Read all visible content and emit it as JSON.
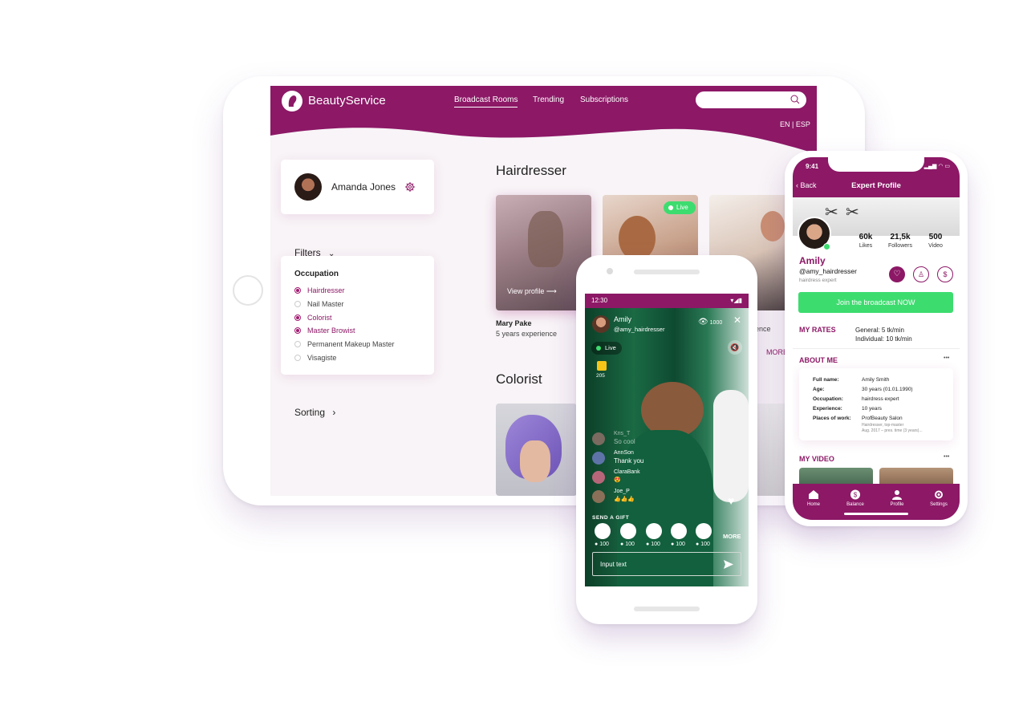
{
  "web": {
    "brand": "BeautyService",
    "nav": [
      "Broadcast Rooms",
      "Trending",
      "Subscriptions"
    ],
    "lang": "EN | ESP",
    "user_name": "Amanda Jones",
    "filters_label": "Filters",
    "occupation_title": "Occupation",
    "occupations": [
      {
        "label": "Hairdresser",
        "checked": true
      },
      {
        "label": "Nail Master",
        "checked": false
      },
      {
        "label": "Colorist",
        "checked": true
      },
      {
        "label": "Master Browist",
        "checked": true
      },
      {
        "label": "Permanent Makeup Master",
        "checked": false
      },
      {
        "label": "Visagiste",
        "checked": false
      }
    ],
    "sorting_label": "Sorting",
    "section1_title": "Hairdresser",
    "section2_title": "Colorist",
    "view_profile": "View profile",
    "expert_name": "Mary Pake",
    "expert_experience": "5 years experience",
    "live_badge": "Live",
    "partial_text": "ence",
    "more_link": "MORE"
  },
  "android": {
    "time": "12:30",
    "host_name": "Amily",
    "host_handle": "@amy_hairdresser",
    "viewers": "1000",
    "live_badge": "Live",
    "coin_count": "205",
    "chat": [
      {
        "user": "Kris_T",
        "text": "So cool"
      },
      {
        "user": "AnnSon",
        "text": "Thank you"
      },
      {
        "user": "ClaraBank",
        "text": "😍"
      },
      {
        "user": "Joe_P",
        "text": "👍👍👍"
      }
    ],
    "send_gift_label": "SEND A GIFT",
    "gift_more": "MORE",
    "gift_prices": [
      "100",
      "100",
      "100",
      "100",
      "100"
    ],
    "input_placeholder": "Input text"
  },
  "iphone": {
    "time": "9:41",
    "back_label": "Back",
    "title": "Expert Profile",
    "stats": [
      {
        "value": "60k",
        "label": "Likes"
      },
      {
        "value": "21,5k",
        "label": "Followers"
      },
      {
        "value": "500",
        "label": "Video"
      }
    ],
    "name": "Amily",
    "handle": "@amy_hairdresser",
    "role": "hairdress expert",
    "join_button": "Join the broadcast NOW",
    "rates_title": "MY RATES",
    "rate_general": "General: 5 tk/min",
    "rate_individual": "Individual: 10 tk/min",
    "about_title": "ABOUT ME",
    "about": [
      {
        "key": "Full name:",
        "value": "Amily Smith"
      },
      {
        "key": "Age:",
        "value": "30 years (01.01.1990)"
      },
      {
        "key": "Occupation:",
        "value": "hairdress expert"
      },
      {
        "key": "Experience:",
        "value": "10 years"
      },
      {
        "key": "Places of work:",
        "value": "ProfBeauty Salon"
      }
    ],
    "work_sub1": "Hairdresser, top-master",
    "work_sub2": "Aug. 2017 – pres. time (3 years)...",
    "video_title": "MY VIDEO",
    "more_dots": "•••",
    "tabs": [
      "Home",
      "Balance",
      "Profile",
      "Settings"
    ]
  },
  "colors": {
    "brand": "#8c1866",
    "accent_green": "#3ddc6f",
    "background": "#f8f4f7"
  }
}
